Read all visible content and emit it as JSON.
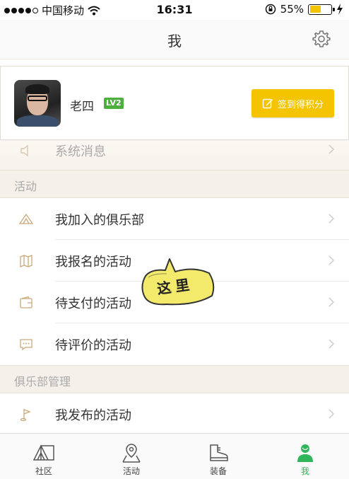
{
  "status_bar": {
    "carrier": "中国移动",
    "time": "16:31",
    "battery": "55%",
    "battery_level": 0.55,
    "icons": [
      "signal-dots-icon",
      "wifi-icon",
      "orientation-lock-icon",
      "battery-icon",
      "charging-icon"
    ]
  },
  "nav": {
    "title": "我",
    "settings_icon": "gear-icon"
  },
  "profile": {
    "username": "老四",
    "level": "LV2",
    "checkin_label": "签到得积分",
    "checkin_icon": "edit-icon",
    "accent": "#f5c400",
    "level_color": "#4caf3e"
  },
  "system_row": {
    "label": "系统消息",
    "icon": "speaker-icon"
  },
  "activity_section": {
    "title": "活动",
    "items": [
      {
        "label": "我加入的俱乐部",
        "icon": "tent-icon"
      },
      {
        "label": "我报名的活动",
        "icon": "map-icon"
      },
      {
        "label": "待支付的活动",
        "icon": "wallet-icon"
      },
      {
        "label": "待评价的活动",
        "icon": "comment-icon"
      }
    ]
  },
  "club_section": {
    "title": "俱乐部管理",
    "items": [
      {
        "label": "我发布的活动",
        "icon": "flag-icon"
      }
    ]
  },
  "sticker": {
    "text": "这里",
    "color": "#f3ea6b"
  },
  "tabs": [
    {
      "label": "社区",
      "icon": "tent-icon"
    },
    {
      "label": "活动",
      "icon": "map-pin-icon"
    },
    {
      "label": "装备",
      "icon": "boot-icon"
    },
    {
      "label": "我",
      "icon": "person-icon",
      "active": true
    }
  ],
  "colors": {
    "active_tab": "#2fb55a",
    "icon_tan": "#c9a97a"
  }
}
